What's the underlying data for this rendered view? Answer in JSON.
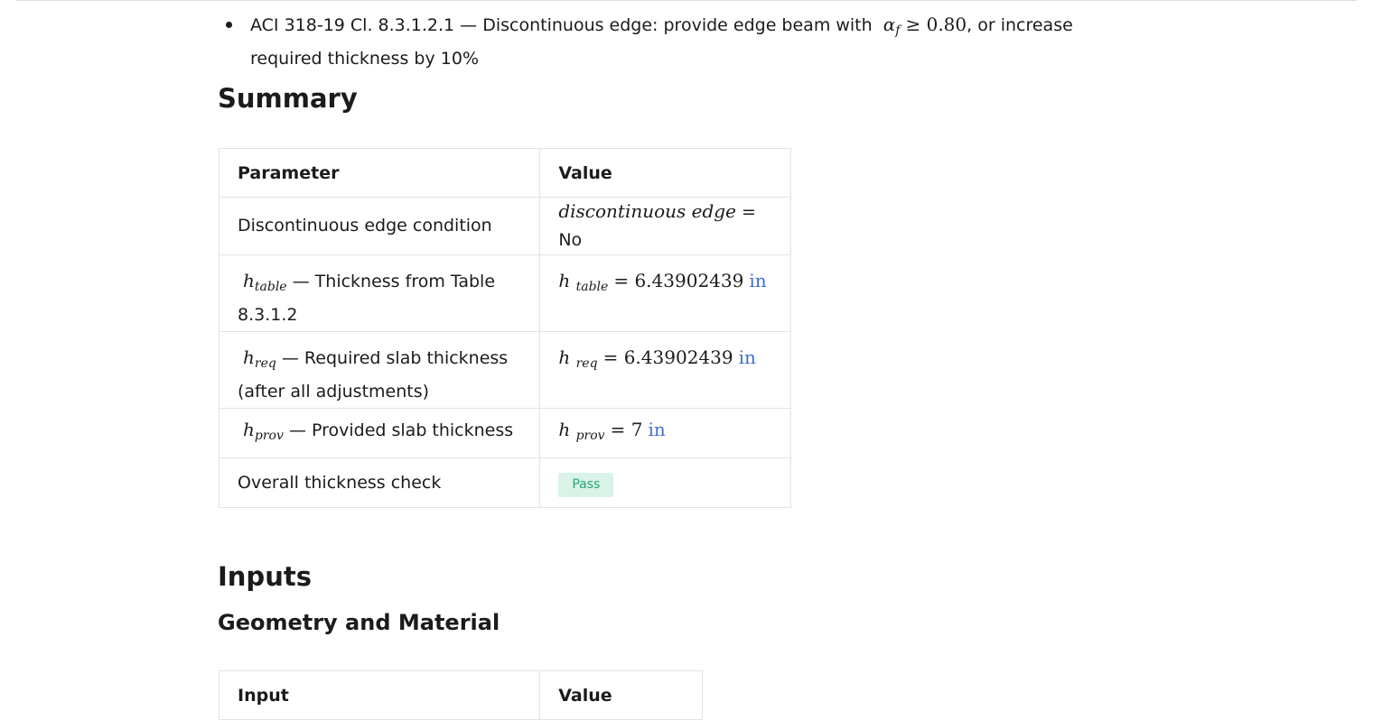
{
  "bullet": {
    "prefix": "ACI 318-19 Cl. 8.3.1.2.1 — Discontinuous edge: provide edge beam with",
    "math_symbol": "α",
    "math_sub": "f",
    "math_rel": "≥ 0.80",
    "suffix": ", or increase required thickness by 10%"
  },
  "summary": {
    "heading": "Summary",
    "col_param": "Parameter",
    "col_value": "Value",
    "rows": [
      {
        "param_text": "Discontinuous edge condition",
        "value_math": "discontinuous edge",
        "value_text": "= No"
      },
      {
        "param_sym": "h",
        "param_sub": "table",
        "param_text": "— Thickness from Table 8.3.1.2",
        "value_sym": "h",
        "value_sub": "table",
        "value_num": "= 6.43902439",
        "value_unit": "in"
      },
      {
        "param_sym": "h",
        "param_sub": "req",
        "param_text": "— Required slab thickness (after all adjustments)",
        "value_sym": "h",
        "value_sub": "req",
        "value_num": "= 6.43902439",
        "value_unit": "in"
      },
      {
        "param_sym": "h",
        "param_sub": "prov",
        "param_text": "— Provided slab thickness",
        "value_sym": "h",
        "value_sub": "prov",
        "value_num": "= 7",
        "value_unit": "in"
      },
      {
        "param_text": "Overall thickness check",
        "badge": "Pass"
      }
    ]
  },
  "inputs": {
    "heading": "Inputs",
    "subheading": "Geometry and Material",
    "col_input": "Input",
    "col_value": "Value"
  },
  "colors": {
    "unit": "#3b6fd0",
    "pass_bg": "#d9f3e8",
    "pass_text": "#2aa176"
  }
}
